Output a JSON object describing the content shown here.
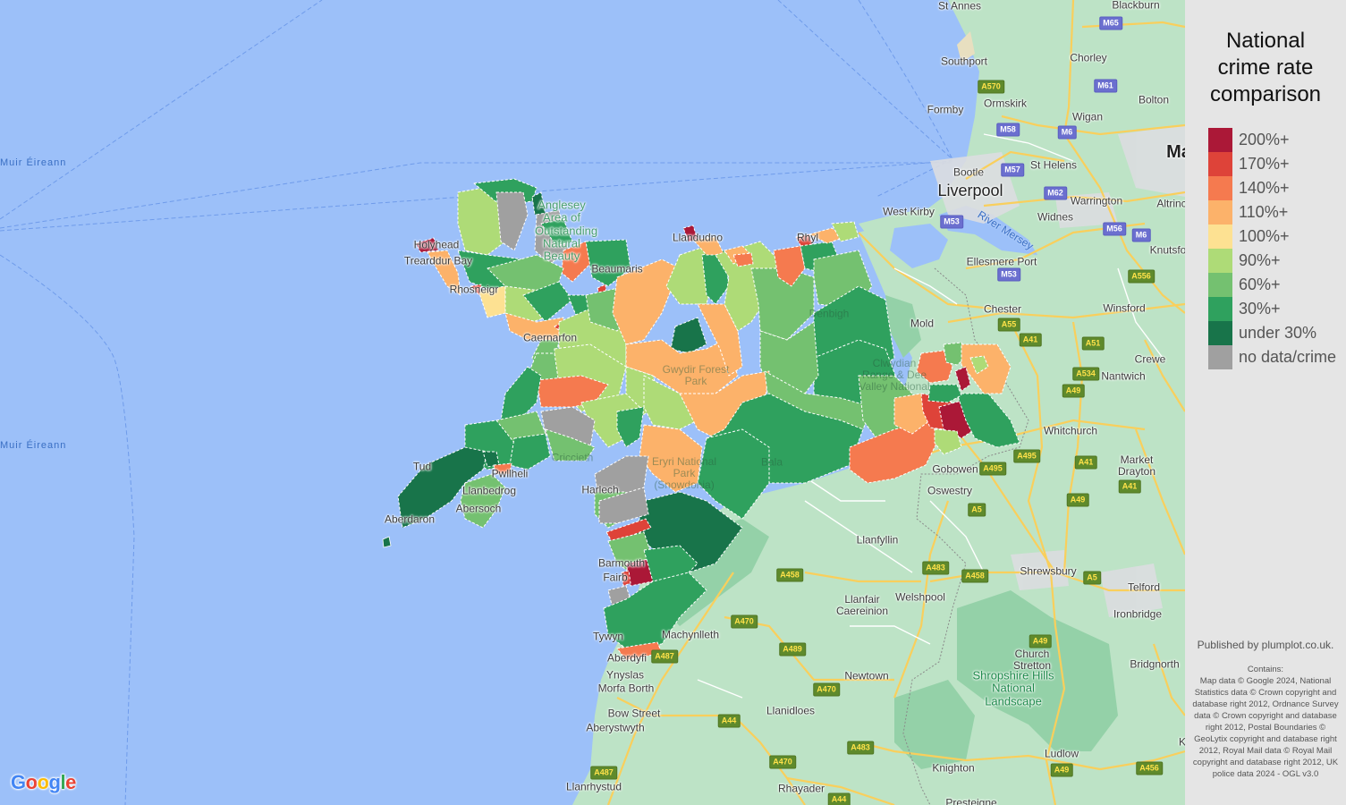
{
  "legend": {
    "title_lines": [
      "National",
      "crime rate",
      "comparison"
    ],
    "items": [
      {
        "label": "200%+",
        "color": "#ab1837"
      },
      {
        "label": "170%+",
        "color": "#de4339"
      },
      {
        "label": "140%+",
        "color": "#f57a4f"
      },
      {
        "label": "110%+",
        "color": "#fcb26a"
      },
      {
        "label": "100%+",
        "color": "#fde192"
      },
      {
        "label": "90%+",
        "color": "#aedb77"
      },
      {
        "label": "60%+",
        "color": "#74c170"
      },
      {
        "label": "30%+",
        "color": "#2fa15e"
      },
      {
        "label": "under 30%",
        "color": "#18744a"
      },
      {
        "label": "no data/crime",
        "color": "#a0a0a0"
      }
    ]
  },
  "attribution": {
    "publisher": "Published by plumplot.co.uk.",
    "contains_label": "Contains:",
    "credits": "Map data © Google 2024, National Statistics data © Crown copyright and database right 2012, Ordnance Survey data © Crown copyright and database right 2012, Postal Boundaries © GeoLytix copyright and database right 2012, Royal Mail data © Royal Mail copyright and database right 2012, UK police data 2024 - OGL v3.0"
  },
  "map": {
    "logo": {
      "letters": [
        "G",
        "o",
        "o",
        "g",
        "l",
        "e"
      ],
      "colors": [
        "#4285f4",
        "#ea4335",
        "#fbbc05",
        "#4285f4",
        "#34a853",
        "#ea4335"
      ]
    },
    "sea_labels": [
      "Muir Éireann",
      "Muir Éireann"
    ],
    "places": {
      "st_annes": "St Annes",
      "blackburn": "Blackburn",
      "southport": "Southport",
      "chorley": "Chorley",
      "ormskirk": "Ormskirk",
      "bolton": "Bolton",
      "formby": "Formby",
      "wigan": "Wigan",
      "manchester": "Ma",
      "bootle": "Bootle",
      "st_helens": "St Helens",
      "liverpool": "Liverpool",
      "warrington": "Warrington",
      "altrincham": "Altrinc",
      "west_kirby": "West Kirby",
      "widnes": "Widnes",
      "knutsford": "Knutsfo",
      "ellesmere_port": "Ellesmere Port",
      "chester": "Chester",
      "winsford": "Winsford",
      "mold": "Mold",
      "crewe": "Crewe",
      "nantwich": "Nantwich",
      "whitchurch": "Whitchurch",
      "market_drayton": "Market Drayton",
      "gobowen": "Gobowen",
      "oswestry": "Oswestry",
      "llanfyllin": "Llanfyllin",
      "shrewsbury": "Shrewsbury",
      "telford": "Telford",
      "welshpool": "Welshpool",
      "llanfair": "Llanfair Caereinion",
      "ironbridge": "Ironbridge",
      "machynlleth": "Machynlleth",
      "church_stretton": "Church Stretton",
      "bridgnorth": "Bridgnorth",
      "newtown": "Newtown",
      "llanidloes": "Llanidloes",
      "ludlow": "Ludlow",
      "knighton": "Knighton",
      "rhayader": "Rhayader",
      "presteigne": "Presteigne",
      "aberdyfi": "Aberdyfi",
      "ynyslas": "Ynyslas",
      "morfa_borth": "Morfa Borth",
      "bow_street": "Bow Street",
      "aberystwyth": "Aberystwyth",
      "llanrhystud": "Llanrhystud",
      "tywyn": "Tywyn",
      "barmouth": "Barmouth",
      "fairbourne": "Fairb",
      "harlech": "Harlech",
      "abersoch": "Abersoch",
      "llanbedrog": "Llanbedrog",
      "pwllheli": "Pwllheli",
      "tudweiliog": "Tud",
      "aberdaron": "Aberdaron",
      "holyhead": "Holyhead",
      "trearddur": "Trearddur Bay",
      "rhosneigr": "Rhosneigr",
      "beaumaris": "Beaumaris",
      "llandudno": "Llandudno",
      "caernarfon": "Caernarfon",
      "rhyl": "Rhyl",
      "bala": "Bala",
      "denbigh": "Denbigh",
      "criccieth": "Criccieth",
      "kidderminster": "K",
      "river_mersey": "River Mersey"
    },
    "parks": {
      "anglesey_aonb": "Anglesey Area of Outstanding Natural Beauty",
      "shropshire_hills": "Shropshire Hills National Landscape",
      "clwydian": "Clwydian Range & Dee Valley National",
      "eryri": "Eryri National Park (Snowdonia)",
      "gwydir": "Gwydir Forest Park"
    },
    "roads": {
      "m65": "M65",
      "m61": "M61",
      "m58": "M58",
      "m6a": "M6",
      "m57": "M57",
      "m62": "M62",
      "m53a": "M53",
      "m56": "M56",
      "m6b": "M6",
      "m53b": "M53",
      "a570": "A570",
      "a556": "A556",
      "a55": "A55",
      "a41a": "A41",
      "a51": "A51",
      "a534": "A534",
      "a49a": "A49",
      "a495a": "A495",
      "a495b": "A495",
      "a41b": "A41",
      "a41c": "A41",
      "a5a": "A5",
      "a49b": "A49",
      "a483a": "A483",
      "a458a": "A458",
      "a5b": "A5",
      "a458b": "A458",
      "a470a": "A470",
      "a489": "A489",
      "a487a": "A487",
      "a470b": "A470",
      "a44a": "A44",
      "a483b": "A483",
      "a470c": "A470",
      "a49c": "A49",
      "a487b": "A487",
      "a44b": "A44",
      "a49d": "A49",
      "a456": "A456"
    }
  }
}
